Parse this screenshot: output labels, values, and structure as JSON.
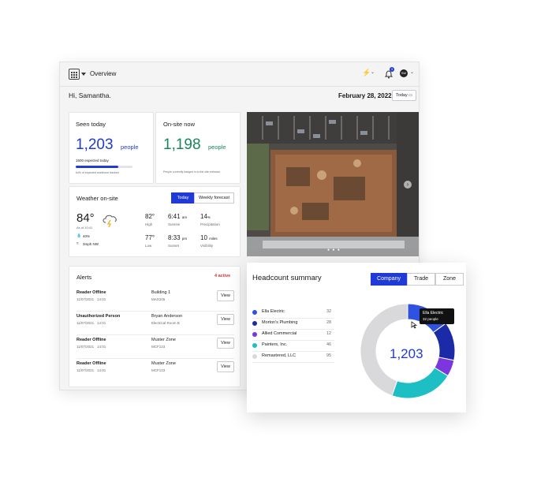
{
  "topbar": {
    "title": "Overview",
    "bell_badge": "3",
    "avatar_initials": "SW"
  },
  "greeting": {
    "hello": "Hi, Samantha.",
    "date": "February 28, 2022",
    "today_btn": "Today"
  },
  "seen_today": {
    "title": "Seen today",
    "count": "1,203",
    "unit": "people",
    "expected": "1600 expected today",
    "note": "64% of expected workforce tracked",
    "progress_fraction": 0.75
  },
  "onsite": {
    "title": "On-site now",
    "count": "1,198",
    "unit": "people",
    "note": "People currently badged in to the site entrance"
  },
  "weather": {
    "title": "Weather on-site",
    "tabs": [
      "Today",
      "Weekly forecast"
    ],
    "temp": "84°",
    "asof": "As of 10:41",
    "humidity": "40%",
    "wind": "3mph NW",
    "high_val": "82°",
    "high_lbl": "High",
    "low_val": "77°",
    "low_lbl": "Low",
    "sunrise_val": "6:41",
    "sunrise_ampm": "am",
    "sunrise_lbl": "Sunrise",
    "sunset_val": "8:33",
    "sunset_ampm": "pm",
    "sunset_lbl": "Sunset",
    "precip_val": "14",
    "precip_unit": "%",
    "precip_lbl": "Precipitation",
    "vis_val": "10",
    "vis_unit": "miles",
    "vis_lbl": "Visibility"
  },
  "alerts": {
    "title": "Alerts",
    "active": "4 active",
    "view_label": "View",
    "rows": [
      {
        "type": "Reader Offline",
        "date": "11/07/2021   14:01",
        "loc": "Building 1",
        "sub": "MAX345"
      },
      {
        "type": "Unauthorized Person",
        "date": "11/07/2021   14:01",
        "loc": "Bryan Anderson",
        "sub": "Electrical Room B"
      },
      {
        "type": "Reader Offline",
        "date": "11/07/2021   14:01",
        "loc": "Muster Zone",
        "sub": "MCF123"
      },
      {
        "type": "Reader Offline",
        "date": "11/07/2021   14:01",
        "loc": "Muster Zone",
        "sub": "MCF123"
      }
    ]
  },
  "headcount": {
    "title": "Headcount summary",
    "tabs": [
      "Company",
      "Trade",
      "Zone"
    ],
    "total": "1,203",
    "tooltip_title": "Ella Electric",
    "tooltip_sub": "32 people",
    "legend": [
      {
        "name": "Ella Electric",
        "value": "32",
        "color": "#2f52e0"
      },
      {
        "name": "Morton's Plumbing",
        "value": "28",
        "color": "#1b2aa6"
      },
      {
        "name": "Allied Commercial",
        "value": "12",
        "color": "#7b36e0"
      },
      {
        "name": "Painters, Inc.",
        "value": "46",
        "color": "#1dbfc4"
      },
      {
        "name": "Remastered, LLC",
        "value": "95",
        "color": "#d9d9dc"
      }
    ]
  },
  "colors": {
    "brand": "#1f3ad6",
    "onsite": "#17865b",
    "alert": "#e03030"
  }
}
